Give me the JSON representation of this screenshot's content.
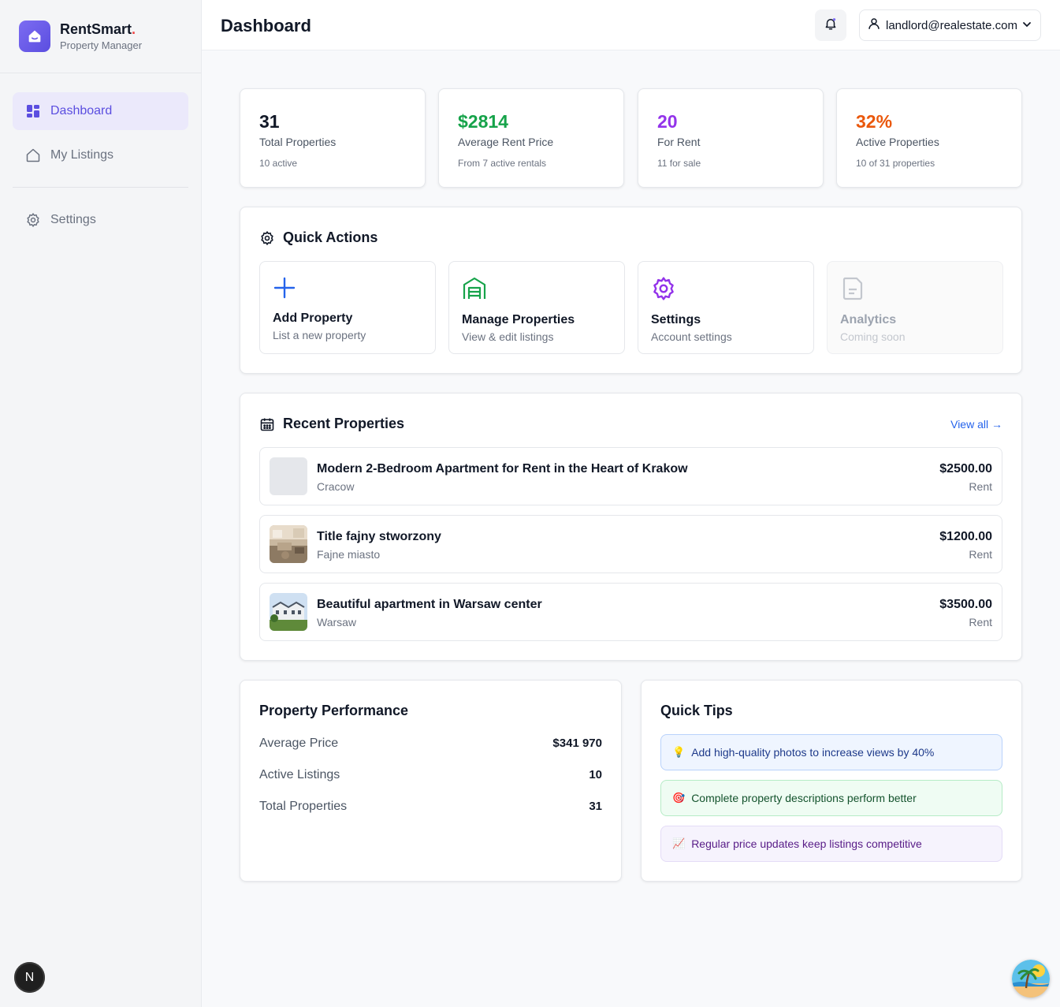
{
  "brand": {
    "name": "RentSmart",
    "dot": ".",
    "subtitle": "Property Manager"
  },
  "sidebar": {
    "items": [
      {
        "label": "Dashboard",
        "icon": "dashboard-icon",
        "active": true
      },
      {
        "label": "My Listings",
        "icon": "home-icon",
        "active": false
      },
      {
        "label": "Settings",
        "icon": "gear-icon",
        "active": false
      }
    ]
  },
  "header": {
    "title": "Dashboard",
    "user_email": "landlord@realestate.com"
  },
  "stats": [
    {
      "value": "31",
      "label": "Total Properties",
      "sub": "10 active",
      "color": "#111827"
    },
    {
      "value": "$2814",
      "label": "Average Rent Price",
      "sub": "From 7 active rentals",
      "color": "#16a34a"
    },
    {
      "value": "20",
      "label": "For Rent",
      "sub": "11 for sale",
      "color": "#9333ea"
    },
    {
      "value": "32%",
      "label": "Active Properties",
      "sub": "10 of 31 properties",
      "color": "#ea580c"
    }
  ],
  "quick_actions": {
    "title": "Quick Actions",
    "items": [
      {
        "title": "Add Property",
        "desc": "List a new property",
        "icon": "plus-icon",
        "color": "#2563eb"
      },
      {
        "title": "Manage Properties",
        "desc": "View & edit listings",
        "icon": "warehouse-icon",
        "color": "#16a34a"
      },
      {
        "title": "Settings",
        "desc": "Account settings",
        "icon": "gear-icon",
        "color": "#9333ea"
      },
      {
        "title": "Analytics",
        "desc": "Coming soon",
        "icon": "file-icon",
        "color": "#c3c7ce"
      }
    ]
  },
  "recent": {
    "title": "Recent Properties",
    "view_all": "View all →",
    "items": [
      {
        "title": "Modern 2-Bedroom Apartment for Rent in the Heart of Krakow",
        "city": "Cracow",
        "price": "$2500.00",
        "type": "Rent"
      },
      {
        "title": "Title fajny stworzony",
        "city": "Fajne miasto",
        "price": "$1200.00",
        "type": "Rent"
      },
      {
        "title": "Beautiful apartment in Warsaw center",
        "city": "Warsaw",
        "price": "$3500.00",
        "type": "Rent"
      }
    ]
  },
  "performance": {
    "title": "Property Performance",
    "rows": [
      {
        "label": "Average Price",
        "value": "$341 970"
      },
      {
        "label": "Active Listings",
        "value": "10"
      },
      {
        "label": "Total Properties",
        "value": "31"
      }
    ]
  },
  "tips": {
    "title": "Quick Tips",
    "items": [
      {
        "emoji": "💡",
        "text": "Add high-quality photos to increase views by 40%"
      },
      {
        "emoji": "🎯",
        "text": "Complete property descriptions perform better"
      },
      {
        "emoji": "📈",
        "text": "Regular price updates keep listings competitive"
      }
    ]
  },
  "badge": {
    "letter": "N"
  }
}
